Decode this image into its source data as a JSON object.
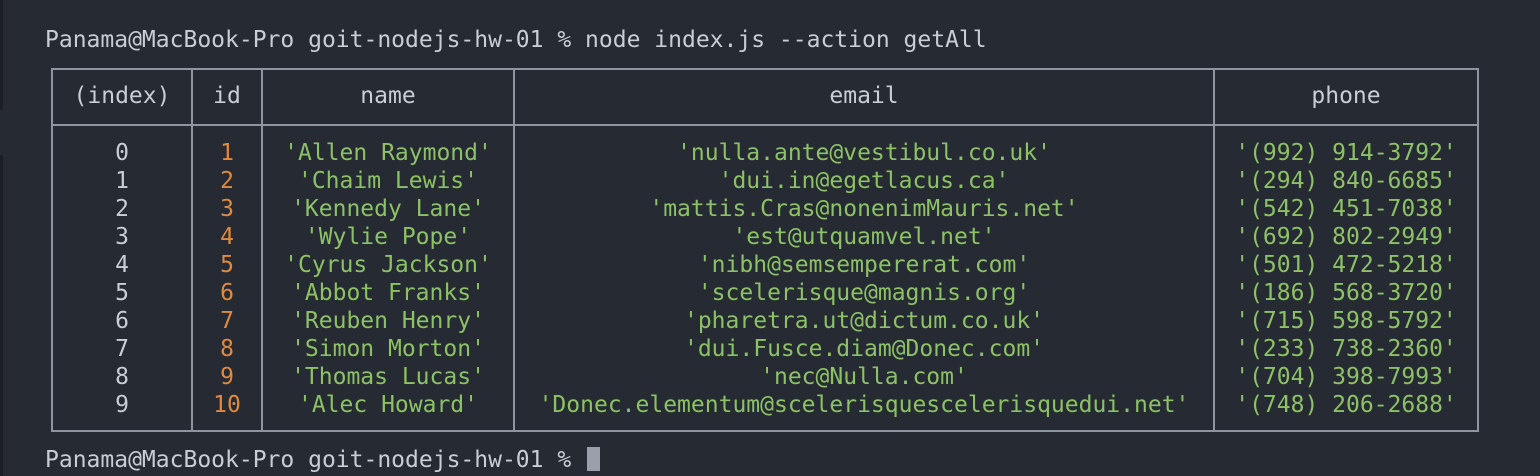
{
  "terminal": {
    "command_line": "Panama@MacBook-Pro goit-nodejs-hw-01 % node index.js --action getAll",
    "prompt_line": "Panama@MacBook-Pro goit-nodejs-hw-01 % "
  },
  "table": {
    "headers": {
      "index": "(index)",
      "id": "id",
      "name": "name",
      "email": "email",
      "phone": "phone"
    },
    "rows": [
      {
        "index": "0",
        "id": "1",
        "name": "'Allen Raymond'",
        "email": "'nulla.ante@vestibul.co.uk'",
        "phone": "'(992) 914-3792'"
      },
      {
        "index": "1",
        "id": "2",
        "name": "'Chaim Lewis'",
        "email": "'dui.in@egetlacus.ca'",
        "phone": "'(294) 840-6685'"
      },
      {
        "index": "2",
        "id": "3",
        "name": "'Kennedy Lane'",
        "email": "'mattis.Cras@nonenimMauris.net'",
        "phone": "'(542) 451-7038'"
      },
      {
        "index": "3",
        "id": "4",
        "name": "'Wylie Pope'",
        "email": "'est@utquamvel.net'",
        "phone": "'(692) 802-2949'"
      },
      {
        "index": "4",
        "id": "5",
        "name": "'Cyrus Jackson'",
        "email": "'nibh@semsempererat.com'",
        "phone": "'(501) 472-5218'"
      },
      {
        "index": "5",
        "id": "6",
        "name": "'Abbot Franks'",
        "email": "'scelerisque@magnis.org'",
        "phone": "'(186) 568-3720'"
      },
      {
        "index": "6",
        "id": "7",
        "name": "'Reuben Henry'",
        "email": "'pharetra.ut@dictum.co.uk'",
        "phone": "'(715) 598-5792'"
      },
      {
        "index": "7",
        "id": "8",
        "name": "'Simon Morton'",
        "email": "'dui.Fusce.diam@Donec.com'",
        "phone": "'(233) 738-2360'"
      },
      {
        "index": "8",
        "id": "9",
        "name": "'Thomas Lucas'",
        "email": "'nec@Nulla.com'",
        "phone": "'(704) 398-7993'"
      },
      {
        "index": "9",
        "id": "10",
        "name": "'Alec Howard'",
        "email": "'Donec.elementum@scelerisquescelerisquedui.net'",
        "phone": "'(748) 206-2688'"
      }
    ]
  },
  "colors": {
    "background": "#262a33",
    "text": "#c8cdd6",
    "number": "#e08a3c",
    "string": "#8cc265",
    "border": "#8f959f"
  }
}
